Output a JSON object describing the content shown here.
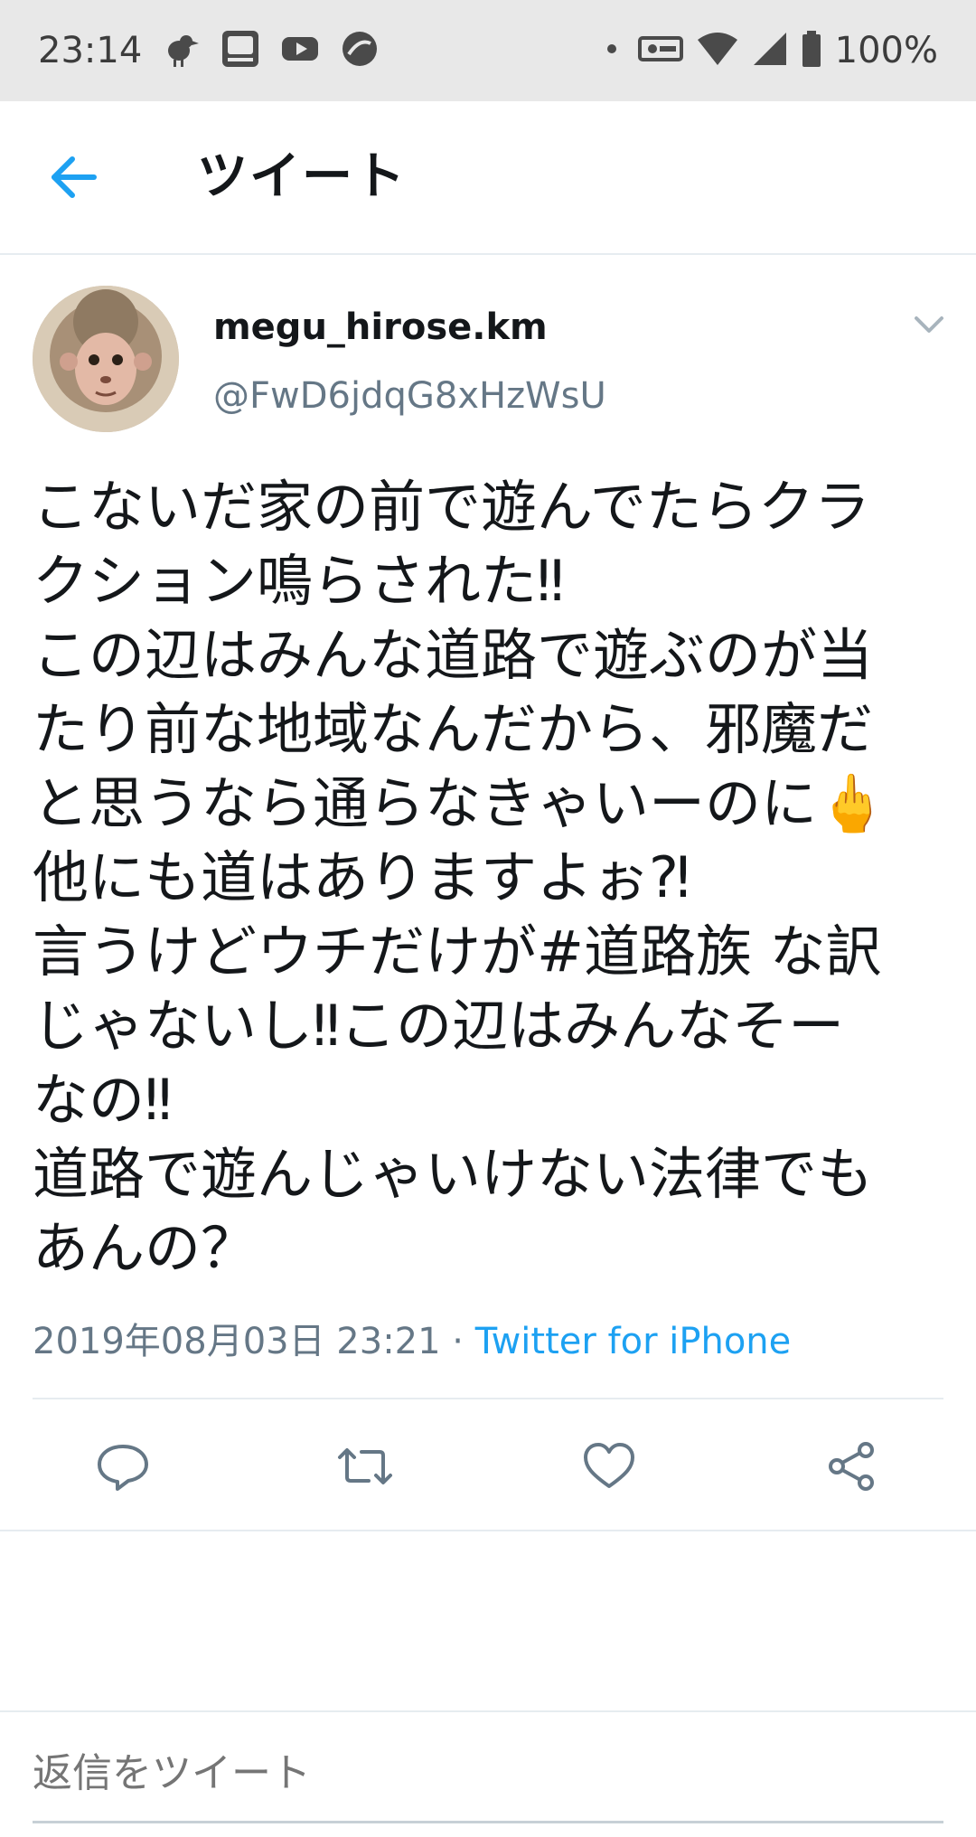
{
  "status_bar": {
    "time": "23:14",
    "battery": "100%",
    "app_icons": [
      "bird-app-icon",
      "sugi-pharmacy-icon",
      "youtube-icon",
      "circle-app-icon"
    ],
    "sys_icons": [
      "dot-icon",
      "vpn-key-icon",
      "wifi-icon",
      "signal-icon",
      "battery-icon"
    ]
  },
  "header": {
    "title": "ツイート",
    "back_icon": "arrow-left-icon"
  },
  "tweet": {
    "display_name": "megu_hirose.km",
    "handle": "@FwD6jdqG8xHzWsU",
    "text_lines": [
      "こないだ家の前で遊んでたらクラ",
      "クション鳴らされた‼︎",
      "この辺はみんな道路で遊ぶのが当",
      "たり前な地域なんだから、邪魔だ",
      "と思うなら通らなきゃいーのに🖕",
      "他にも道はありますよぉ⁈",
      "言うけどウチだけが#道路族 な訳",
      "じゃないし‼︎この辺はみんなそー",
      "なの‼︎",
      "道路で遊んじゃいけない法律でも",
      "あんの？"
    ],
    "timestamp": "2019年08月03日 23:21",
    "separator": " · ",
    "source": "Twitter for iPhone"
  },
  "actions": {
    "reply_icon": "reply-icon",
    "retweet_icon": "retweet-icon",
    "like_icon": "heart-icon",
    "share_icon": "share-icon"
  },
  "reply_box": {
    "placeholder": "返信をツイート"
  },
  "colors": {
    "accent": "#1da1f2",
    "text": "#14171a",
    "secondary": "#657786",
    "status_bar_bg": "#e8e8e8"
  }
}
